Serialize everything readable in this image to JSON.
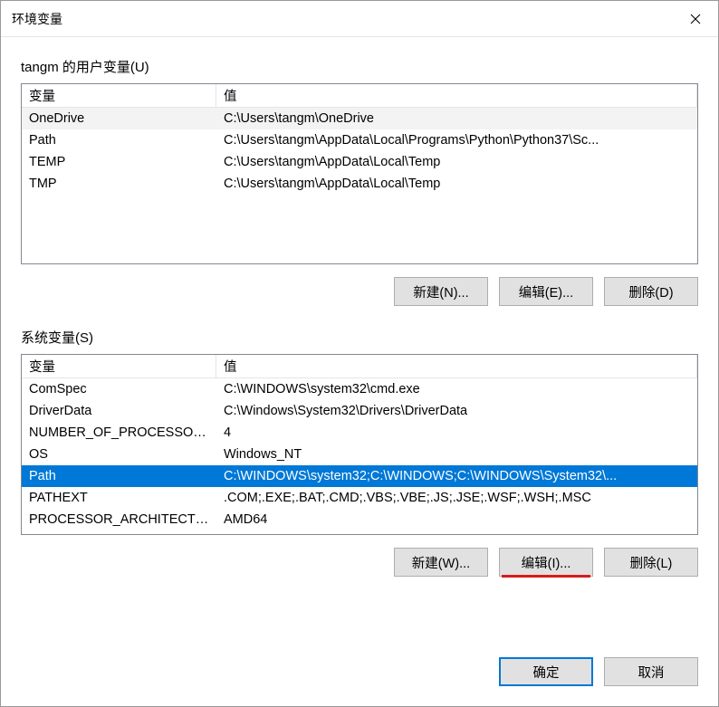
{
  "window": {
    "title": "环境变量"
  },
  "user_section": {
    "label": "tangm 的用户变量(U)",
    "header_var": "变量",
    "header_val": "值",
    "rows": [
      {
        "var": "OneDrive",
        "val": "C:\\Users\\tangm\\OneDrive",
        "highlight": true
      },
      {
        "var": "Path",
        "val": "C:\\Users\\tangm\\AppData\\Local\\Programs\\Python\\Python37\\Sc..."
      },
      {
        "var": "TEMP",
        "val": "C:\\Users\\tangm\\AppData\\Local\\Temp"
      },
      {
        "var": "TMP",
        "val": "C:\\Users\\tangm\\AppData\\Local\\Temp"
      }
    ],
    "buttons": {
      "new": "新建(N)...",
      "edit": "编辑(E)...",
      "delete": "删除(D)"
    }
  },
  "sys_section": {
    "label": "系统变量(S)",
    "header_var": "变量",
    "header_val": "值",
    "rows": [
      {
        "var": "ComSpec",
        "val": "C:\\WINDOWS\\system32\\cmd.exe"
      },
      {
        "var": "DriverData",
        "val": "C:\\Windows\\System32\\Drivers\\DriverData"
      },
      {
        "var": "NUMBER_OF_PROCESSORS",
        "val": "4"
      },
      {
        "var": "OS",
        "val": "Windows_NT"
      },
      {
        "var": "Path",
        "val": "C:\\WINDOWS\\system32;C:\\WINDOWS;C:\\WINDOWS\\System32\\...",
        "selected": true
      },
      {
        "var": "PATHEXT",
        "val": ".COM;.EXE;.BAT;.CMD;.VBS;.VBE;.JS;.JSE;.WSF;.WSH;.MSC"
      },
      {
        "var": "PROCESSOR_ARCHITECTURE",
        "val": "AMD64"
      }
    ],
    "buttons": {
      "new": "新建(W)...",
      "edit": "编辑(I)...",
      "delete": "删除(L)"
    }
  },
  "footer": {
    "ok": "确定",
    "cancel": "取消"
  }
}
